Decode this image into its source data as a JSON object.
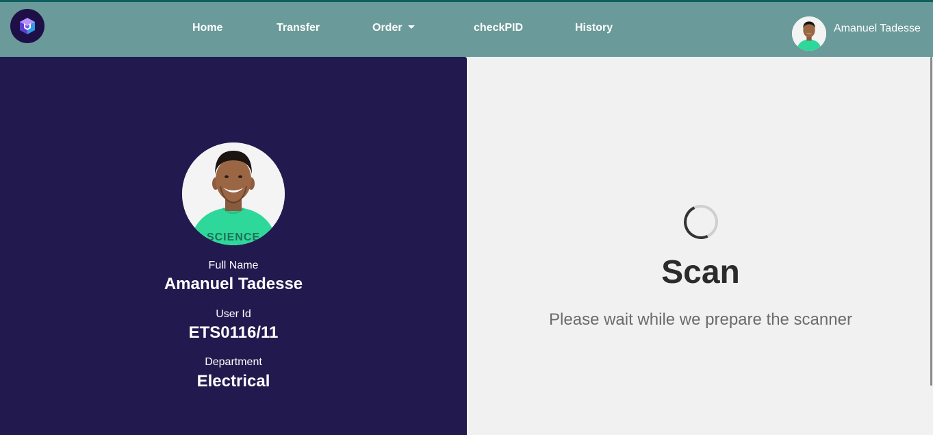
{
  "navbar": {
    "logo_icon": "cube-logo-icon",
    "items": [
      {
        "label": "Home"
      },
      {
        "label": "Transfer"
      },
      {
        "label": "Order",
        "has_dropdown": true
      },
      {
        "label": "checkPID"
      },
      {
        "label": "History"
      }
    ],
    "user": {
      "name": "Amanuel Tadesse",
      "avatar_icon": "user-avatar"
    }
  },
  "profile": {
    "photo_icon": "profile-photo",
    "fields": [
      {
        "label": "Full Name",
        "value": "Amanuel Tadesse"
      },
      {
        "label": "User Id",
        "value": "ETS0116/11"
      },
      {
        "label": "Department",
        "value": "Electrical"
      }
    ]
  },
  "scanner": {
    "title": "Scan",
    "message": "Please wait while we prepare the scanner",
    "spinner_icon": "loading-spinner-icon"
  },
  "colors": {
    "navbar_bg": "#6a9a99",
    "topline": "#0f5f61",
    "panel_bg": "#221a4e",
    "page_bg": "#f1f1f1",
    "shirt": "#2ed89a"
  }
}
